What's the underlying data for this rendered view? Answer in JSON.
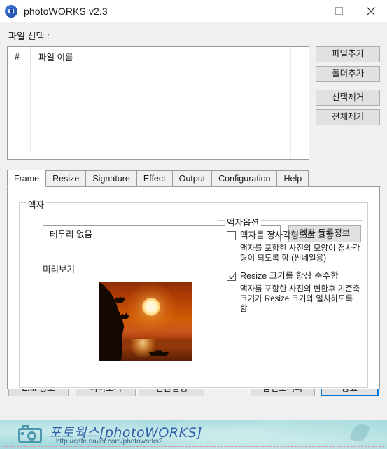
{
  "window": {
    "title": "photoWORKS v2.3",
    "icon": "camera-icon",
    "minimize_label": "—",
    "maximize_label": "□",
    "close_label": "✕"
  },
  "file_section": {
    "label": "파일 선택 :",
    "columns": [
      "#",
      "파일 이름"
    ],
    "rows": [],
    "buttons": [
      {
        "label": "파일추가"
      },
      {
        "label": "폴더추가"
      },
      {
        "label": "선택제거"
      },
      {
        "label": "전체제거"
      }
    ]
  },
  "tabs": [
    {
      "label": "Frame",
      "active": true
    },
    {
      "label": "Resize",
      "active": false
    },
    {
      "label": "Signature",
      "active": false
    },
    {
      "label": "Effect",
      "active": false
    },
    {
      "label": "Output",
      "active": false
    },
    {
      "label": "Configuration",
      "active": false
    },
    {
      "label": "Help",
      "active": false
    }
  ],
  "frame_tab": {
    "group_title": "액자",
    "frame_select": {
      "value": "테두리 없음",
      "arrow": "∨"
    },
    "frame_info_button": "액자 등록정보",
    "preview_label": "미리보기",
    "preview_image_alt": "sunset-photo-thumbnail",
    "options_group_title": "액자옵션",
    "options": [
      {
        "label": "액자를 정사각형으로 고정",
        "checked": false,
        "description": "액자를 포함한 사진의 모양이 정사각형이 되도록 함 (썬네일용)"
      },
      {
        "label": "Resize 크기를 항상 준수함",
        "checked": true,
        "description": "액자를 포함한 사진의 변환후 기준축 크기가 Resize 크기와 일치하도록 함"
      }
    ]
  },
  "bottom_buttons": {
    "exif": "Exif 정보",
    "preview": "미리보기",
    "convert": "변환실행",
    "reset_options": "옵션초기화",
    "exit": "종료"
  },
  "banner": {
    "title": "포토웍스[photoWORKS]",
    "url": "http://cafe.naver.com/photoworks2",
    "icon": "camera-icon"
  },
  "colors": {
    "accent": "#0078d7",
    "button_face": "#e1e1e1",
    "window_bg": "#f0f0f0",
    "banner_bg": "#a8dee0",
    "banner_text": "#2f5fa8"
  }
}
